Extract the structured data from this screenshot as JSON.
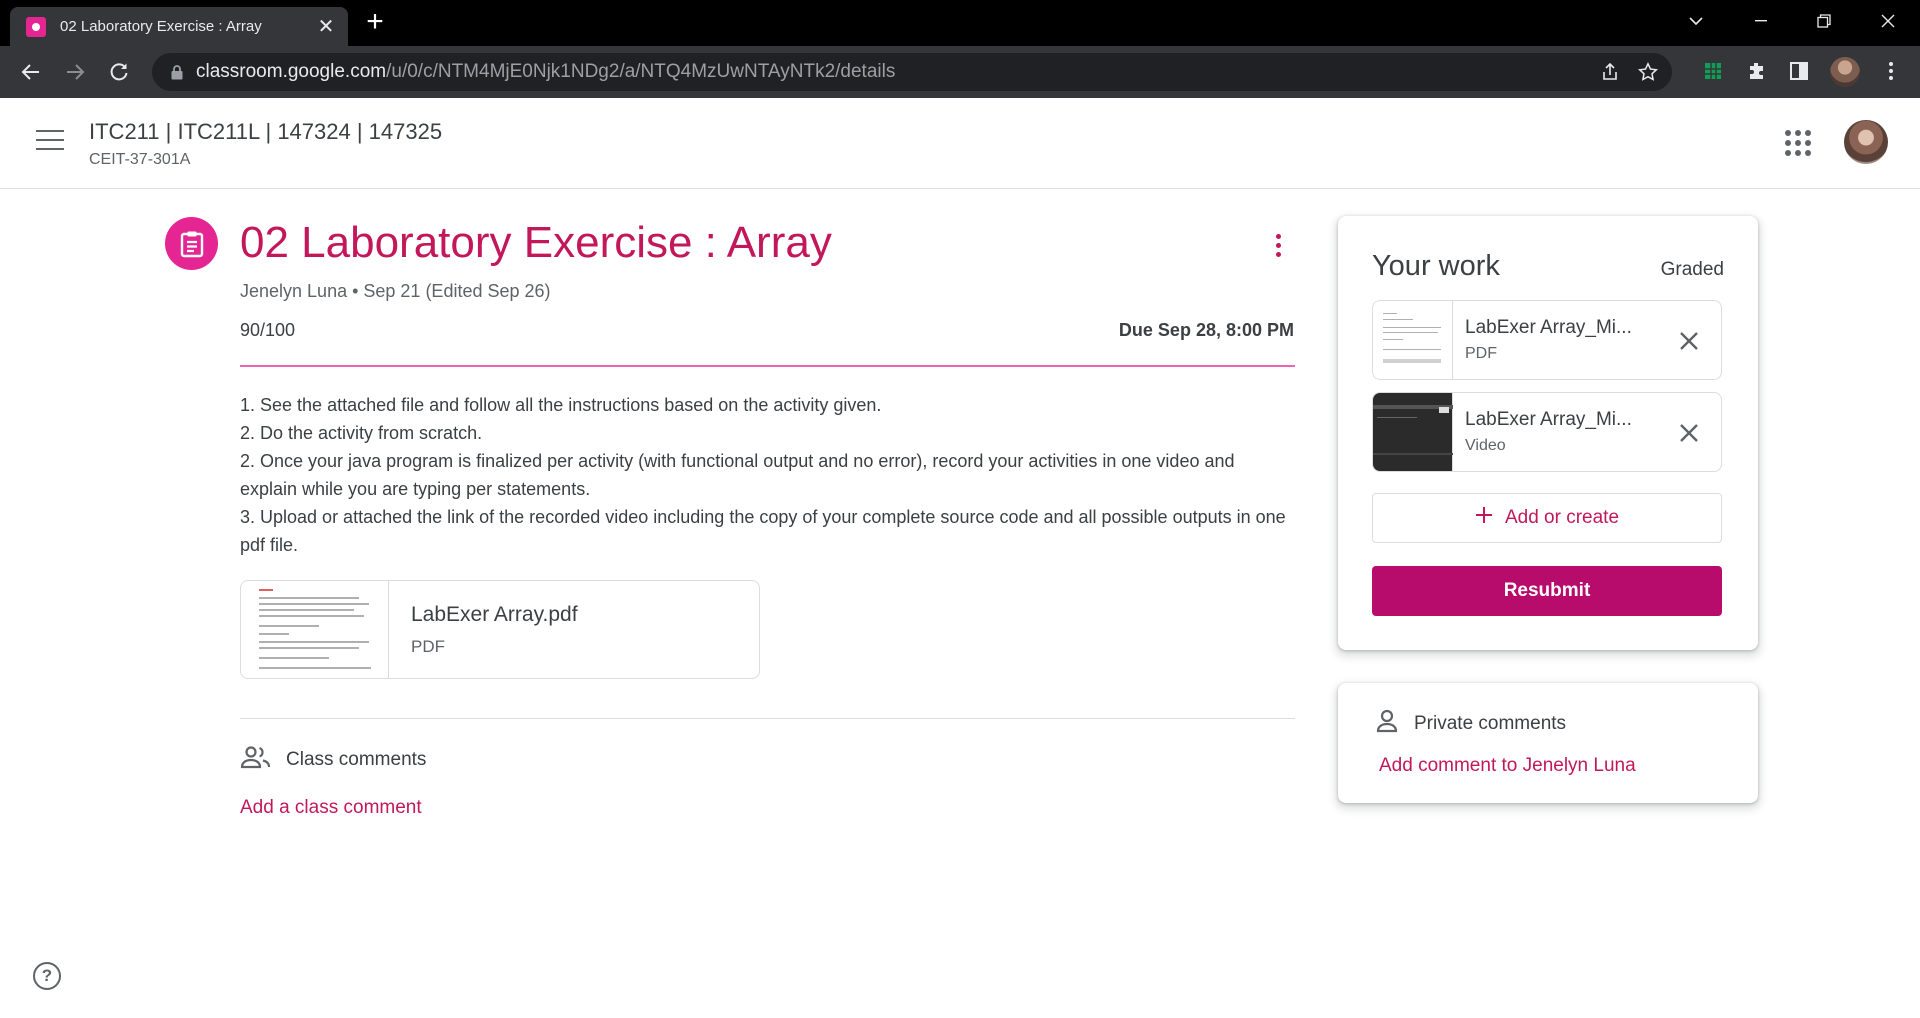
{
  "browser": {
    "tab_title": "02 Laboratory Exercise : Array",
    "url_host": "classroom.google.com",
    "url_path": "/u/0/c/NTM4MjE0Njk1NDg2/a/NTQ4MzUwNTAyNTk2/details"
  },
  "header": {
    "course_title": "ITC211 | ITC211L | 147324 | 147325",
    "course_section": "CEIT-37-301A"
  },
  "assignment": {
    "title": "02 Laboratory Exercise : Array",
    "meta": "Jenelyn Luna • Sep 21 (Edited Sep 26)",
    "points": "90/100",
    "due": "Due Sep 28, 8:00 PM",
    "instructions": [
      "1. See the attached file and follow all the instructions based on the activity given.",
      "2. Do the activity from scratch.",
      "2. Once your java program is finalized per activity (with functional output and no error), record your activities in one video and explain while you are typing per statements.",
      "3. Upload or attached the link of the recorded video including the copy of your complete source code and all possible outputs in one pdf file."
    ],
    "attachment": {
      "name": "LabExer Array.pdf",
      "type": "PDF"
    }
  },
  "comments": {
    "class_label": "Class comments",
    "add_class": "Add a class comment"
  },
  "your_work": {
    "title": "Your work",
    "status": "Graded",
    "files": [
      {
        "name": "LabExer Array_Mi...",
        "type": "PDF"
      },
      {
        "name": "LabExer Array_Mi...",
        "type": "Video"
      }
    ],
    "add_create": "Add or create",
    "resubmit": "Resubmit"
  },
  "private_comments": {
    "label": "Private comments",
    "add": "Add comment to Jenelyn Luna"
  },
  "icons": {
    "tab_favicon": "classroom-icon",
    "assignment": "assignment-icon",
    "class_comments": "people-icon",
    "private_comments": "person-icon",
    "help": "help-icon"
  },
  "colors": {
    "accent": "#c2185b",
    "accent_icon": "#e52592",
    "button": "#b80c6d"
  }
}
